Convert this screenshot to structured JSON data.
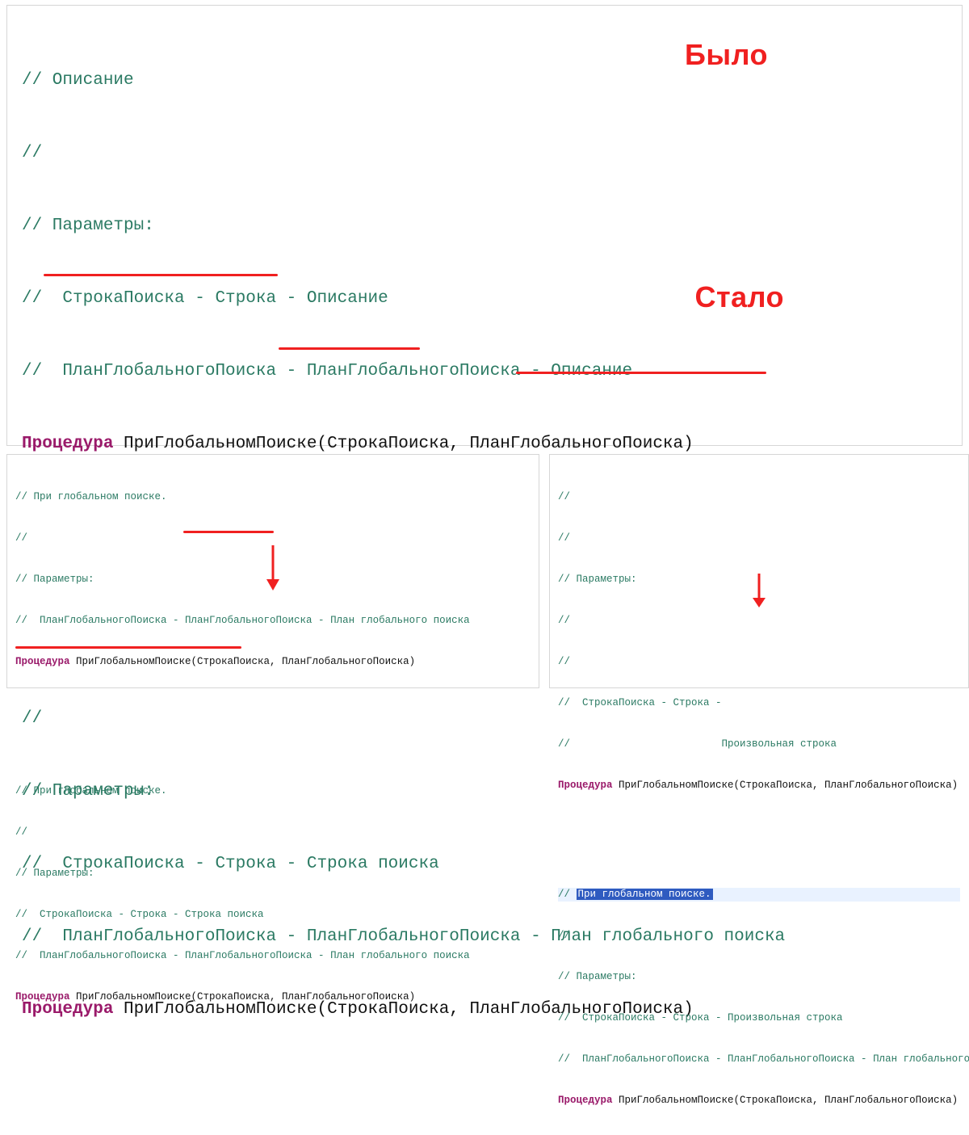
{
  "labels": {
    "was": "Было",
    "became": "Стало"
  },
  "big_before": {
    "l1": "// Описание",
    "l2": "//",
    "l3": "// Параметры:",
    "l4": "//  СтрокаПоиска - Строка - Описание",
    "l5": "//  ПланГлобальногоПоиска - ПланГлобальногоПоиска - Описание",
    "proc_kw": "Процедура",
    "proc_sig": " ПриГлобальномПоиске(СтрокаПоиска, ПланГлобальногоПоиска)"
  },
  "big_after": {
    "l1": "// При глобальном поиске.",
    "l2": "//",
    "l3": "// Параметры:",
    "l4": "//  СтрокаПоиска - Строка - Строка поиска",
    "l5": "//  ПланГлобальногоПоиска - ПланГлобальногоПоиска - План глобального поиска",
    "proc_kw": "Процедура",
    "proc_sig": " ПриГлобальномПоиске(СтрокаПоиска, ПланГлобальногоПоиска)"
  },
  "small_left_top": {
    "l1": "// При глобальном поиске.",
    "l2": "//",
    "l3": "// Параметры:",
    "l4": "//  ПланГлобальногоПоиска - ПланГлобальногоПоиска - План глобального поиска",
    "proc_kw": "Процедура",
    "proc_sig": " ПриГлобальномПоиске(СтрокаПоиска, ПланГлобальногоПоиска)"
  },
  "small_left_bottom": {
    "l1": "// При глобальном поиске.",
    "l2": "//",
    "l3": "// Параметры:",
    "l4": "//  СтрокаПоиска - Строка - Строка поиска",
    "l5": "//  ПланГлобальногоПоиска - ПланГлобальногоПоиска - План глобального поиска",
    "proc_kw": "Процедура",
    "proc_sig": " ПриГлобальномПоиске(СтрокаПоиска, ПланГлобальногоПоиска)"
  },
  "small_right_top": {
    "l1": "//",
    "l2": "//",
    "l3": "// Параметры:",
    "l4": "//",
    "l5": "//",
    "l6": "//  СтрокаПоиска - Строка -",
    "l6b": "//                         Произвольная строка",
    "proc_kw": "Процедура",
    "proc_sig": " ПриГлобальномПоиске(СтрокаПоиска, ПланГлобальногоПоиска)"
  },
  "small_right_bottom": {
    "l1_pre": "// ",
    "l1_sel": "При глобальном поиске.",
    "l2": "//",
    "l3": "// Параметры:",
    "l4": "//  СтрокаПоиска - Строка - Произвольная строка",
    "l5": "//  ПланГлобальногоПоиска - ПланГлобальногоПоиска - План глобального поиска",
    "proc_kw": "Процедура",
    "proc_sig": " ПриГлобальномПоиске(СтрокаПоиска, ПланГлобальногоПоиска)"
  }
}
